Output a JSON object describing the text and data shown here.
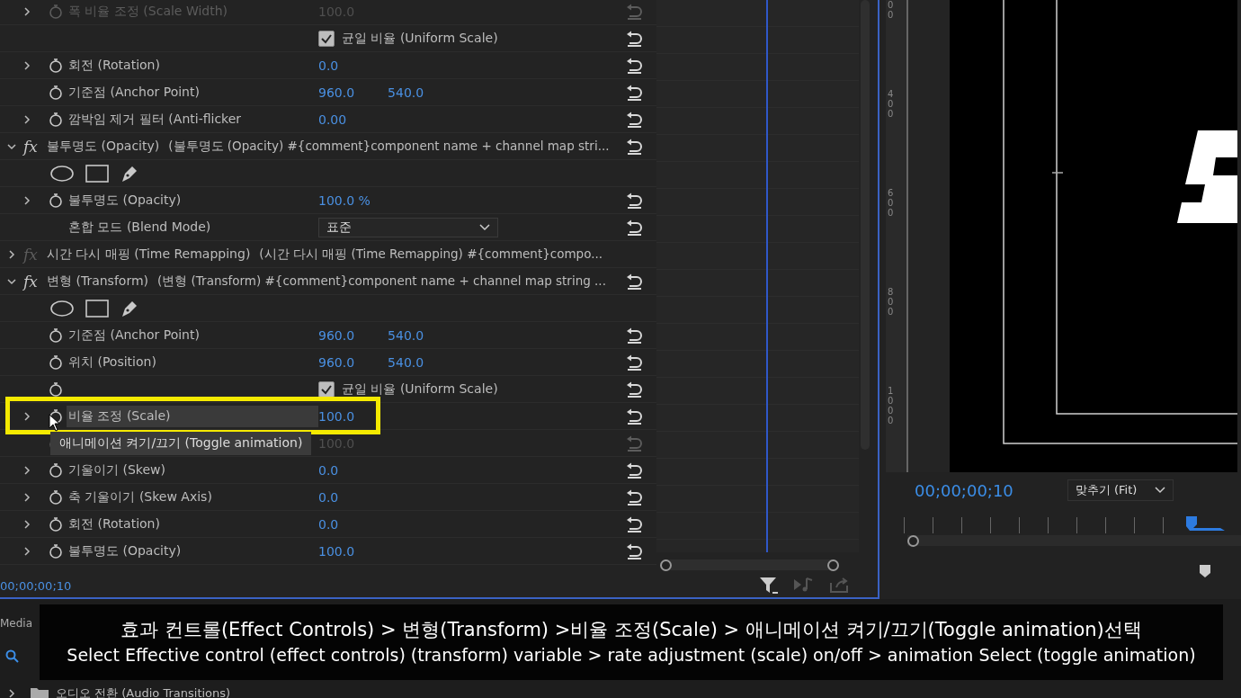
{
  "effect_controls": {
    "rows": [
      {
        "kind": "param",
        "label": "폭 비율 조정 (Scale Width)",
        "expandable": true,
        "disabled": true,
        "selected": false,
        "outlined": false,
        "values": [
          "100.0"
        ]
      },
      {
        "kind": "checkbox",
        "label": "균일 비율 (Uniform Scale)",
        "stopwatch": false,
        "checked": true
      },
      {
        "kind": "param",
        "label": "회전 (Rotation)",
        "expandable": true,
        "disabled": false,
        "selected": false,
        "outlined": false,
        "values": [
          "0.0"
        ]
      },
      {
        "kind": "param",
        "label": "기준점 (Anchor Point)",
        "expandable": false,
        "disabled": false,
        "selected": false,
        "outlined": false,
        "values": [
          "960.0",
          "540.0"
        ]
      },
      {
        "kind": "param",
        "label": "깜박임 제거 필터 (Anti-flicker",
        "expandable": true,
        "disabled": false,
        "selected": false,
        "outlined": false,
        "values": [
          "0.00"
        ]
      },
      {
        "kind": "effect",
        "icon": "fx",
        "label": "불투명도 (Opacity)",
        "detail": "(불투명도 (Opacity)  #{comment}component name + channel map stri...",
        "expanded": true,
        "disabled": false,
        "resettable": true
      },
      {
        "kind": "masks"
      },
      {
        "kind": "param",
        "label": "불투명도 (Opacity)",
        "expandable": true,
        "disabled": false,
        "selected": false,
        "outlined": false,
        "values": [
          "100.0 %"
        ]
      },
      {
        "kind": "dropdown",
        "label": "혼합 모드 (Blend Mode)",
        "value": "표준"
      },
      {
        "kind": "effect",
        "icon": "fx",
        "label": "시간 다시 매핑 (Time Remapping)",
        "detail": "(시간 다시 매핑 (Time Remapping)  #{comment}compo...",
        "expanded": false,
        "disabled": true,
        "resettable": false
      },
      {
        "kind": "effect",
        "icon": "fx",
        "label": "변형 (Transform)",
        "detail": "(변형 (Transform)  #{comment}component name + channel map string ...",
        "expanded": true,
        "disabled": false,
        "resettable": true
      },
      {
        "kind": "masks"
      },
      {
        "kind": "param",
        "label": "기준점 (Anchor Point)",
        "expandable": false,
        "disabled": false,
        "selected": false,
        "outlined": false,
        "values": [
          "960.0",
          "540.0"
        ]
      },
      {
        "kind": "param",
        "label": "위치 (Position)",
        "expandable": false,
        "disabled": false,
        "selected": false,
        "outlined": false,
        "values": [
          "960.0",
          "540.0"
        ]
      },
      {
        "kind": "checkbox",
        "label": "균일 비율 (Uniform Scale)",
        "stopwatch": true,
        "checked": true
      },
      {
        "kind": "param",
        "label": "비율 조정 (Scale)",
        "expandable": true,
        "disabled": false,
        "selected": true,
        "outlined": true,
        "values": [
          "100.0"
        ]
      },
      {
        "kind": "param",
        "expandable": false,
        "disabled": true,
        "selected": false,
        "outlined": false,
        "values": [
          "100.0"
        ]
      },
      {
        "kind": "param",
        "label": "기울이기 (Skew)",
        "expandable": true,
        "disabled": false,
        "selected": false,
        "outlined": false,
        "values": [
          "0.0"
        ]
      },
      {
        "kind": "param",
        "label": "축 기울이기 (Skew Axis)",
        "expandable": true,
        "disabled": false,
        "selected": false,
        "outlined": false,
        "values": [
          "0.0"
        ]
      },
      {
        "kind": "param",
        "label": "회전 (Rotation)",
        "expandable": true,
        "disabled": false,
        "selected": false,
        "outlined": false,
        "values": [
          "0.0"
        ]
      },
      {
        "kind": "param",
        "label": "불투명도 (Opacity)",
        "expandable": true,
        "disabled": false,
        "selected": false,
        "outlined": false,
        "values": [
          "100.0"
        ]
      }
    ],
    "timecode": "00;00;00;10"
  },
  "tooltip": "애니메이션 켜기/끄기 (Toggle animation)",
  "program_monitor": {
    "ruler_labels": [
      "00",
      "400",
      "600",
      "800",
      "1000"
    ],
    "timecode": "00;00;00;10",
    "zoom": "맞추기 (Fit)"
  },
  "lower_panel": {
    "tab": "Media",
    "item": "오디오 전환 (Audio Transitions)"
  },
  "subtitles": [
    "효과 컨트롤(Effect Controls) > 변형(Transform) >비율 조정(Scale) > 애니메이션 켜기/끄기(Toggle animation)선택",
    "Select Effective control (effect controls) (transform) variable >   rate adjustment (scale) on/off > animation Select (toggle animation)"
  ]
}
